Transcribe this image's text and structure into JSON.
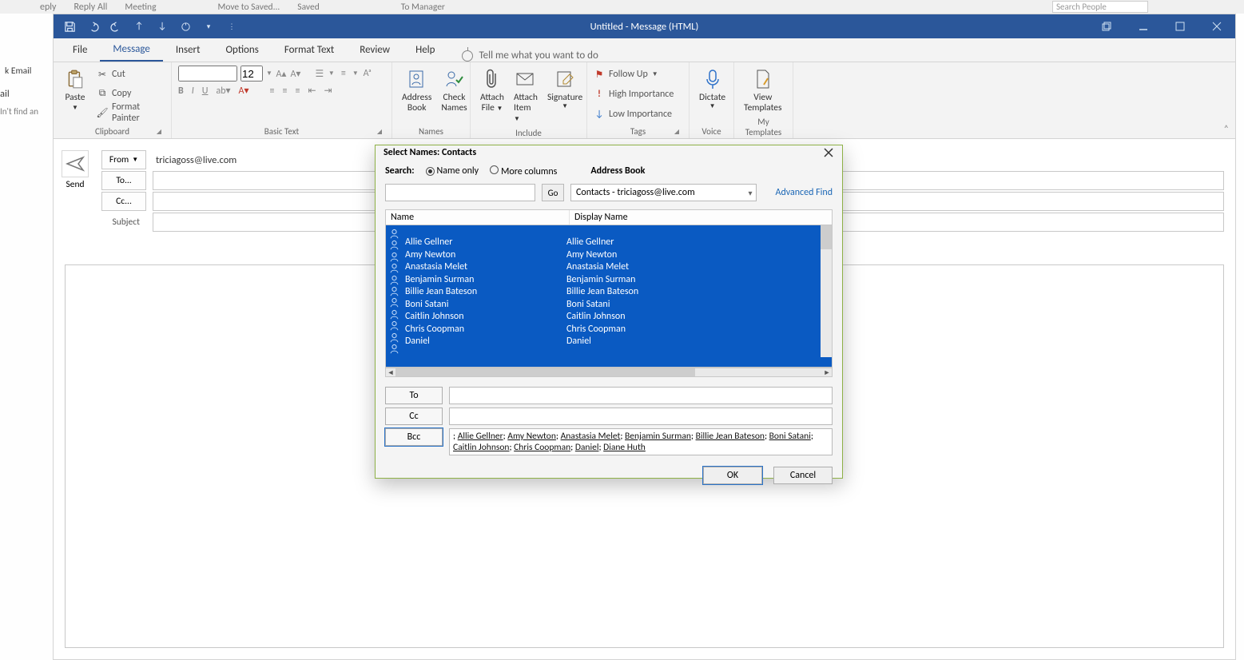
{
  "bg_top": {
    "reply": "eply",
    "reply_all": "Reply All",
    "meeting": "Meeting",
    "move_saved": "Move to Saved...",
    "saved": "Saved",
    "to_manager": "To Manager",
    "search_people_placeholder": "Search People"
  },
  "left_fragment": {
    "email_top": "k Email",
    "ail": "ail",
    "notfound": "In't find an"
  },
  "titlebar": {
    "title": "Untitled  -  Message (HTML)"
  },
  "tabs": {
    "file": "File",
    "message": "Message",
    "insert": "Insert",
    "options": "Options",
    "format": "Format Text",
    "review": "Review",
    "help": "Help",
    "tellme": "Tell me what you want to do"
  },
  "ribbon": {
    "clipboard": {
      "paste": "Paste",
      "cut": "Cut",
      "copy": "Copy",
      "fp": "Format Painter",
      "group": "Clipboard"
    },
    "basictext": {
      "fontsize": "12",
      "group": "Basic Text"
    },
    "names": {
      "ab1": "Address",
      "ab2": "Book",
      "cn1": "Check",
      "cn2": "Names",
      "group": "Names"
    },
    "include": {
      "af1": "Attach",
      "af2": "File",
      "ai1": "Attach",
      "ai2": "Item",
      "sig1": "Signature",
      "group": "Include"
    },
    "tags": {
      "fu": "Follow Up",
      "hi": "High Importance",
      "lo": "Low Importance",
      "group": "Tags"
    },
    "voice": {
      "d": "Dictate",
      "group": "Voice"
    },
    "mytpl": {
      "v1": "View",
      "v2": "Templates",
      "group": "My Templates"
    }
  },
  "compose": {
    "send": "Send",
    "from": "From",
    "from_value": "triciagoss@live.com",
    "to": "To...",
    "cc": "Cc...",
    "subject": "Subject"
  },
  "dialog": {
    "title": "Select Names: Contacts",
    "search": "Search:",
    "name_only": "Name only",
    "more_cols": "More columns",
    "ab_label": "Address Book",
    "go": "Go",
    "combo": "Contacts - triciagoss@live.com",
    "adv": "Advanced Find",
    "hdr_name": "Name",
    "hdr_display": "Display Name",
    "to": "To",
    "cc": "Cc",
    "bcc": "Bcc",
    "ok": "OK",
    "cancel": "Cancel",
    "contacts": [
      "Allie Gellner",
      "Amy Newton",
      "Anastasia Melet",
      "Benjamin Surman",
      "Billie Jean Bateson",
      "Boni Satani",
      "Caitlin Johnson",
      "Chris Coopman",
      "Daniel"
    ],
    "bcc_segments": [
      "; ",
      "Allie Gellner",
      "; ",
      "Amy Newton",
      "; ",
      "Anastasia Melet",
      "; ",
      "Benjamin Surman",
      "; ",
      "Billie Jean Bateson",
      "; ",
      "Boni Satani",
      "; ",
      "Caitlin Johnson",
      "; ",
      "Chris Coopman",
      "; ",
      "Daniel",
      "; ",
      "Diane Huth"
    ]
  }
}
